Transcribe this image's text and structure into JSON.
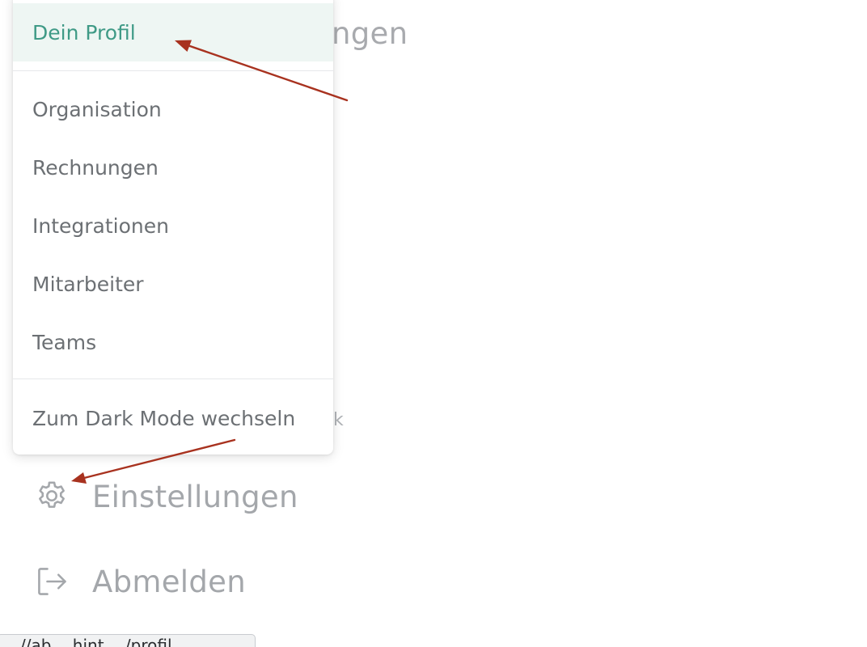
{
  "background": {
    "partial_heading": "ngen",
    "partial_small": "k"
  },
  "sidebar": {
    "settings_label": "Einstellungen",
    "logout_label": "Abmelden"
  },
  "menu": {
    "items": [
      {
        "label": "Dein Profil",
        "active": true
      },
      {
        "label": "Organisation"
      },
      {
        "label": "Rechnungen"
      },
      {
        "label": "Integrationen"
      },
      {
        "label": "Mitarbeiter"
      },
      {
        "label": "Teams"
      },
      {
        "label": "Zum Dark Mode wechseln"
      }
    ]
  },
  "status_bar": {
    "url": "//ab.…hint.…/profil"
  },
  "colors": {
    "accent": "#3f9a86",
    "active_bg": "#eef6f3",
    "annotation_arrow": "#a8321f"
  }
}
